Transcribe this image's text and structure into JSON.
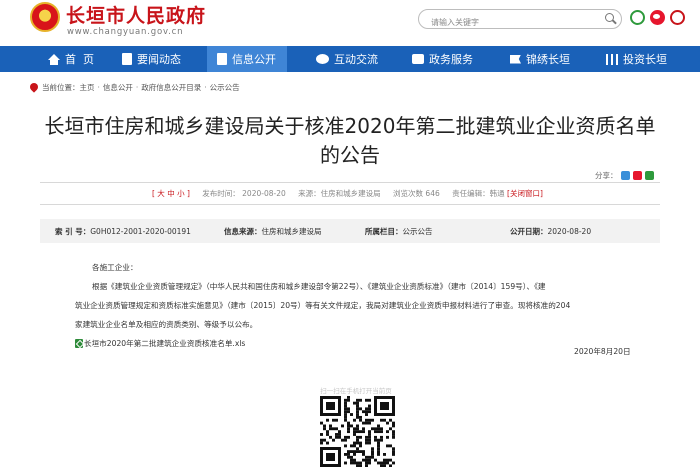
{
  "header": {
    "site_name": "长垣市人民政府",
    "site_url": "www.changyuan.gov.cn",
    "emblem_icon": "national-emblem-icon",
    "search_placeholder": "请输入关键字",
    "social_icons": [
      "wechat-icon",
      "weibo-icon",
      "app-icon"
    ]
  },
  "nav": {
    "items": [
      {
        "label": "首  页",
        "icon": "home-icon"
      },
      {
        "label": "要闻动态",
        "icon": "news-icon"
      },
      {
        "label": "信息公开",
        "icon": "document-icon",
        "active": true
      },
      {
        "label": "互动交流",
        "icon": "chat-icon"
      },
      {
        "label": "政务服务",
        "icon": "service-icon"
      },
      {
        "label": "锦绣长垣",
        "icon": "flag-icon"
      },
      {
        "label": "投资长垣",
        "icon": "invest-icon"
      }
    ],
    "bg_color": "#1a61b8",
    "active_color": "#3f85d6"
  },
  "breadcrumb": {
    "prefix": "当前位置：",
    "items": [
      "主页",
      "信息公开",
      "政府信息公开目录",
      "公示公告"
    ],
    "separator": "·"
  },
  "article": {
    "title": "长垣市住房和城乡建设局关于核准2020年第二批建筑业企业资质名单的公告",
    "share_label": "分享：",
    "font_sizes_label": "[ 大 中 小 ]",
    "publish_time": "发布时间： 2020-08-20",
    "source": "来源：住房和城乡建设局",
    "views": "浏览次数 646",
    "editor": "责任编辑：韩通",
    "close_label": "[关闭窗口]",
    "index": {
      "index_label": "索 引 号：",
      "index_value": "G0H012-2001-2020-00191",
      "source_label": "信息来源：",
      "source_value": "住房和城乡建设局",
      "column_label": "所属栏目：",
      "column_value": "公示公告",
      "date_label": "公开日期：",
      "date_value": "2020-08-20"
    },
    "salutation": "各施工企业：",
    "body_lines": [
      "根据《建筑业企业资质管理规定》（中华人民共和国住房和城乡建设部令第22号）、《建筑业企业资质标准》（建市〔2014〕159号）、《建",
      "筑业企业资质管理规定和资质标准实施意见》（建市〔2015〕20号）等有关文件规定，我局对建筑业企业资质申报材料进行了审查。现将核准的204",
      "家建筑业企业名单及相应的资质类别、等级予以公布。"
    ],
    "attachment": "长垣市2020年第二批建筑企业资质核准名单.xls",
    "sign_date": "2020年8月20日",
    "qr_caption": "扫一扫在手机打开当前页"
  }
}
